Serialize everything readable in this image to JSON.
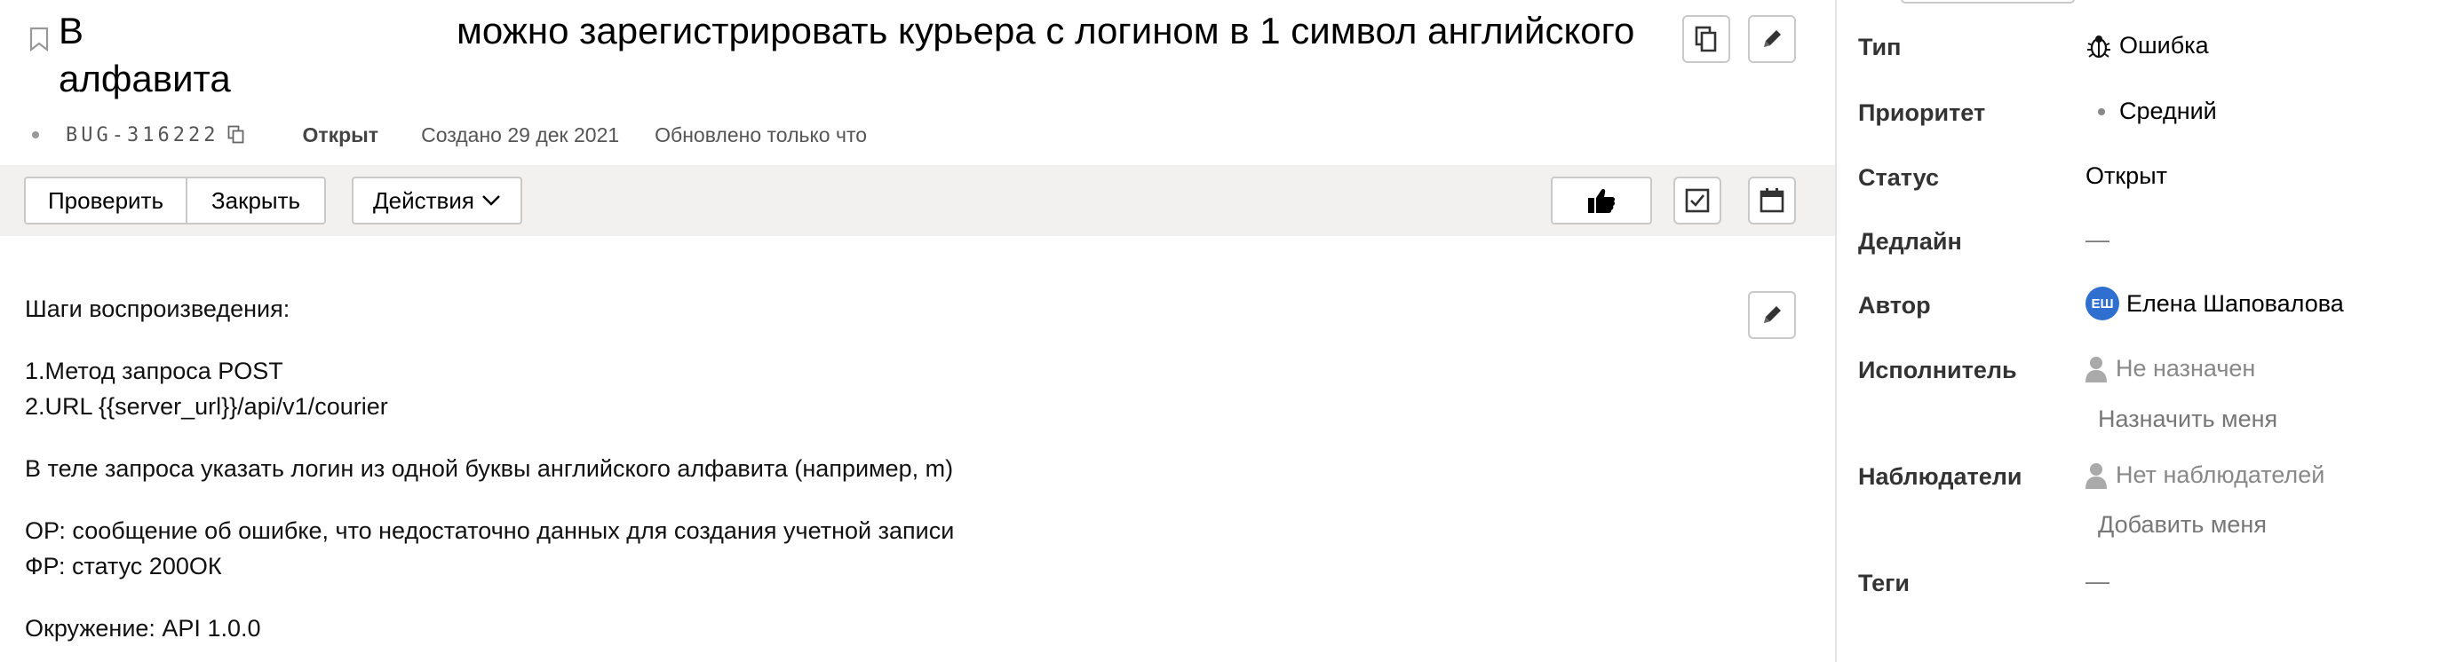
{
  "issue": {
    "title_part1": "В",
    "title_part2": "можно зарегистрировать курьера с логином в 1 символ английского алфавита",
    "key": "BUG-316222",
    "status": "Открыт",
    "created": "Создано 29 дек 2021",
    "updated": "Обновлено только что"
  },
  "toolbar": {
    "check_label": "Проверить",
    "close_label": "Закрыть",
    "actions_label": "Действия"
  },
  "description": {
    "lines": [
      "Шаги воспроизведения:",
      "1.Метод запроса POST",
      "2.URL {{server_url}}/api/v1/courier",
      "В теле запроса указать логин из одной буквы английского алфавита (например, m)",
      "ОР: сообщение об ошибке, что недостаточно данных для создания учетной записи",
      "ФР: статус 200ОК",
      "Окружение: API 1.0.0"
    ]
  },
  "sidebar": {
    "type_label": "Тип",
    "type_value": "Ошибка",
    "priority_label": "Приоритет",
    "priority_value": "Средний",
    "status_label": "Статус",
    "status_value": "Открыт",
    "deadline_label": "Дедлайн",
    "deadline_value": "—",
    "author_label": "Автор",
    "author_initials": "ЕШ",
    "author_value": "Елена Шаповалова",
    "assignee_label": "Исполнитель",
    "assignee_value": "Не назначен",
    "assign_me": "Назначить меня",
    "watchers_label": "Наблюдатели",
    "watchers_value": "Нет наблюдателей",
    "add_me": "Добавить меня",
    "tags_label": "Теги",
    "tags_value": "—"
  },
  "colors": {
    "toolbar_bg": "#f2f1f0",
    "avatar_bg": "#2f6fd0",
    "border": "#c9c9c9"
  }
}
